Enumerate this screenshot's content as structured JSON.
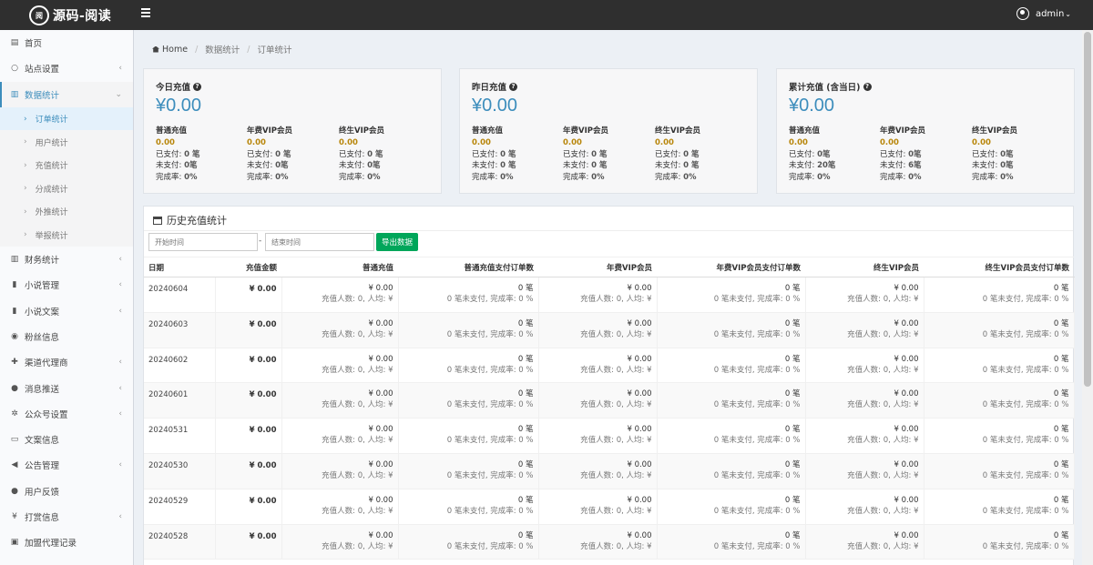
{
  "header": {
    "logo_badge": "阅",
    "title": "源码-阅读",
    "user": "admin"
  },
  "sidebar": {
    "items": [
      {
        "label": "首页",
        "icon": "dashboard-icon",
        "has_arrow": false
      },
      {
        "label": "站点设置",
        "icon": "circle-icon",
        "has_arrow": true
      },
      {
        "label": "数据统计",
        "icon": "bar-chart-icon",
        "has_arrow": true,
        "active": true
      },
      {
        "label": "财务统计",
        "icon": "bar-chart-icon",
        "has_arrow": true
      },
      {
        "label": "小说管理",
        "icon": "book-icon",
        "has_arrow": true
      },
      {
        "label": "小说文案",
        "icon": "book-icon",
        "has_arrow": true
      },
      {
        "label": "粉丝信息",
        "icon": "users-icon",
        "has_arrow": false
      },
      {
        "label": "渠道代理商",
        "icon": "user-plus-icon",
        "has_arrow": true
      },
      {
        "label": "消息推送",
        "icon": "comment-icon",
        "has_arrow": true
      },
      {
        "label": "公众号设置",
        "icon": "cogs-icon",
        "has_arrow": true
      },
      {
        "label": "文案信息",
        "icon": "keyboard-icon",
        "has_arrow": false
      },
      {
        "label": "公告管理",
        "icon": "bullhorn-icon",
        "has_arrow": true
      },
      {
        "label": "用户反馈",
        "icon": "comment-icon",
        "has_arrow": false
      },
      {
        "label": "打赏信息",
        "icon": "yen-icon",
        "has_arrow": true
      },
      {
        "label": "加盟代理记录",
        "icon": "id-card-icon",
        "has_arrow": false
      }
    ],
    "sub_items": [
      "订单统计",
      "用户统计",
      "充值统计",
      "分成统计",
      "外推统计",
      "举报统计"
    ]
  },
  "breadcrumb": {
    "home": "Home",
    "level1": "数据统计",
    "level2": "订单统计"
  },
  "stats": [
    {
      "title": "今日充值",
      "amount": "¥0.00",
      "cols": [
        {
          "name": "普通充值",
          "value": "0.00",
          "paid": "0 笔",
          "unpaid": "0笔",
          "rate": "0%"
        },
        {
          "name": "年费VIP会员",
          "value": "0.00",
          "paid": "0 笔",
          "unpaid": "0笔",
          "rate": "0%"
        },
        {
          "name": "终生VIP会员",
          "value": "0.00",
          "paid": "0 笔",
          "unpaid": "0笔",
          "rate": "0%"
        }
      ]
    },
    {
      "title": "昨日充值",
      "amount": "¥0.00",
      "cols": [
        {
          "name": "普通充值",
          "value": "0.00",
          "paid": "0 笔",
          "unpaid": "0 笔",
          "rate": "0%"
        },
        {
          "name": "年费VIP会员",
          "value": "0.00",
          "paid": "0 笔",
          "unpaid": "0 笔",
          "rate": "0%"
        },
        {
          "name": "终生VIP会员",
          "value": "0.00",
          "paid": "0 笔",
          "unpaid": "0 笔",
          "rate": "0%"
        }
      ]
    },
    {
      "title": "累计充值 (含当日)",
      "amount": "¥0.00",
      "cols": [
        {
          "name": "普通充值",
          "value": "0.00",
          "paid": "0笔",
          "unpaid": "20笔",
          "rate": "0%"
        },
        {
          "name": "年费VIP会员",
          "value": "0.00",
          "paid": "0笔",
          "unpaid": "6笔",
          "rate": "0%"
        },
        {
          "name": "终生VIP会员",
          "value": "0.00",
          "paid": "0笔",
          "unpaid": "0笔",
          "rate": "0%"
        }
      ]
    }
  ],
  "stat_labels": {
    "paid": "已支付: ",
    "unpaid": "未支付: ",
    "rate": "完成率: "
  },
  "history": {
    "title": "历史充值统计",
    "start_placeholder": "开始时间",
    "end_placeholder": "结束时间",
    "dash": "-",
    "export_label": "导出数据",
    "columns": [
      "日期",
      "充值金额",
      "普通充值",
      "普通充值支付订单数",
      "年费VIP会员",
      "年费VIP会员支付订单数",
      "终生VIP会员",
      "终生VIP会员支付订单数"
    ],
    "rows": [
      {
        "date": "20240604",
        "amount": "¥ 0.00"
      },
      {
        "date": "20240603",
        "amount": "¥ 0.00"
      },
      {
        "date": "20240602",
        "amount": "¥ 0.00"
      },
      {
        "date": "20240601",
        "amount": "¥ 0.00"
      },
      {
        "date": "20240531",
        "amount": "¥ 0.00"
      },
      {
        "date": "20240530",
        "amount": "¥ 0.00"
      },
      {
        "date": "20240529",
        "amount": "¥ 0.00"
      },
      {
        "date": "20240528",
        "amount": "¥ 0.00"
      }
    ],
    "cell": {
      "money": "¥ 0.00",
      "money_sub": "充值人数: 0, 人均: ¥",
      "count": "0 笔",
      "count_sub": "0 笔未支付, 完成率: 0 %"
    }
  }
}
